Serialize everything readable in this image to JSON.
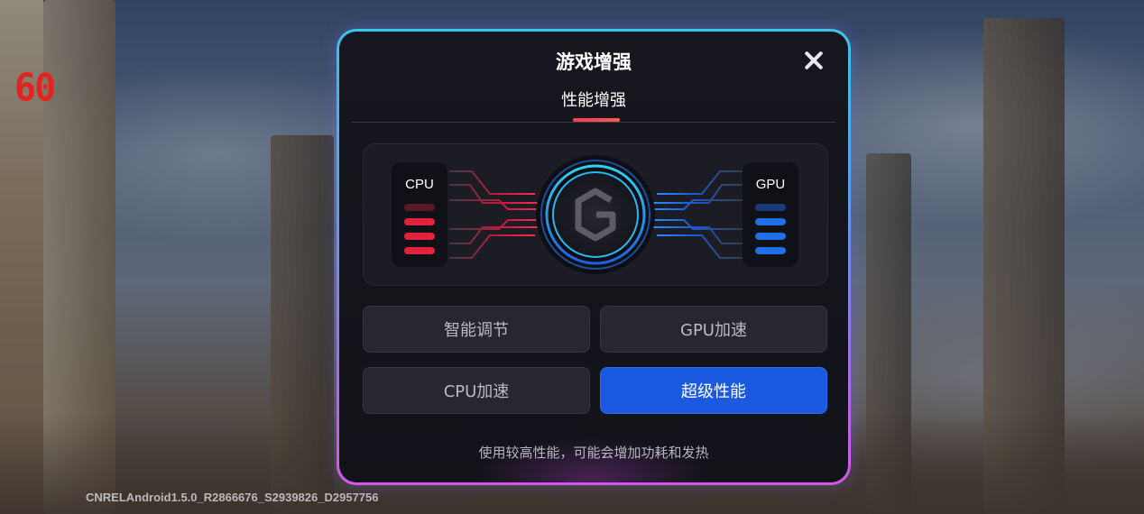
{
  "overlay": {
    "fps_counter": "60",
    "build_info": "CNRELAndroid1.5.0_R2866676_S2939826_D2957756"
  },
  "dialog": {
    "title": "游戏增强",
    "close_icon": "close-icon",
    "tab_label": "性能增强",
    "visual": {
      "cpu_label": "CPU",
      "gpu_label": "GPU",
      "center_icon": "g-logo-icon",
      "cpu_color": "#e4203f",
      "gpu_color": "#1f6fe8"
    },
    "options": [
      {
        "label": "智能调节",
        "selected": false
      },
      {
        "label": "GPU加速",
        "selected": false
      },
      {
        "label": "CPU加速",
        "selected": false
      },
      {
        "label": "超级性能",
        "selected": true
      }
    ],
    "hint": "使用较高性能，可能会增加功耗和发热"
  },
  "colors": {
    "accent_blue": "#1b5ae0",
    "tab_indicator": "#ff3a55",
    "border_gradient_top": "#39c4ea",
    "border_gradient_bottom": "#d557e6",
    "fps_red": "#e4231f"
  }
}
